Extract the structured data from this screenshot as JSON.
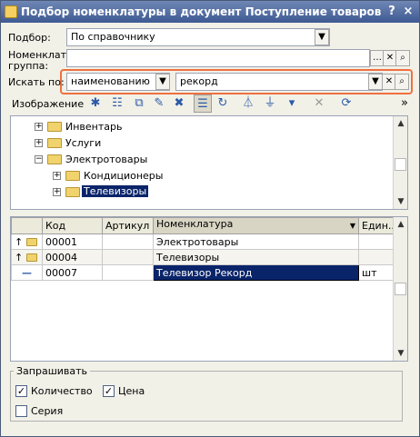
{
  "window": {
    "title": "Подбор номенклатуры в документ Поступление товаров и услуг №...",
    "help_label": "?",
    "close_label": "×"
  },
  "form": {
    "podbor_label": "Подбор:",
    "podbor_value": "По справочнику",
    "group_label_1": "Номенклат.",
    "group_label_2": "группа:",
    "group_value": "",
    "search_label": "Искать по:",
    "search_mode": "наименованию",
    "search_text": "рекорд"
  },
  "toolbar": {
    "image_label": "Изображение"
  },
  "tree": {
    "items": [
      {
        "label": "Инвентарь",
        "expander": "+"
      },
      {
        "label": "Услуги",
        "expander": "+"
      },
      {
        "label": "Электротовары",
        "expander": "−"
      },
      {
        "label": "Кондиционеры",
        "expander": "+"
      },
      {
        "label": "Телевизоры",
        "expander": "+"
      }
    ]
  },
  "table": {
    "columns": [
      "Код",
      "Артикул",
      "Номенклатура",
      "Един..."
    ],
    "rows": [
      {
        "marker": "↑",
        "code": "00001",
        "article": "",
        "name": "Электротовары",
        "unit": ""
      },
      {
        "marker": "↑",
        "code": "00004",
        "article": "",
        "name": "Телевизоры",
        "unit": ""
      },
      {
        "marker": "—",
        "code": "00007",
        "article": "",
        "name": "Телевизор Рекорд",
        "unit": "шт"
      }
    ]
  },
  "ask_group": {
    "title": "Запрашивать",
    "quantity_label": "Количество",
    "quantity_checked": true,
    "price_label": "Цена",
    "price_checked": true,
    "series_label": "Серия",
    "series_checked": false
  }
}
